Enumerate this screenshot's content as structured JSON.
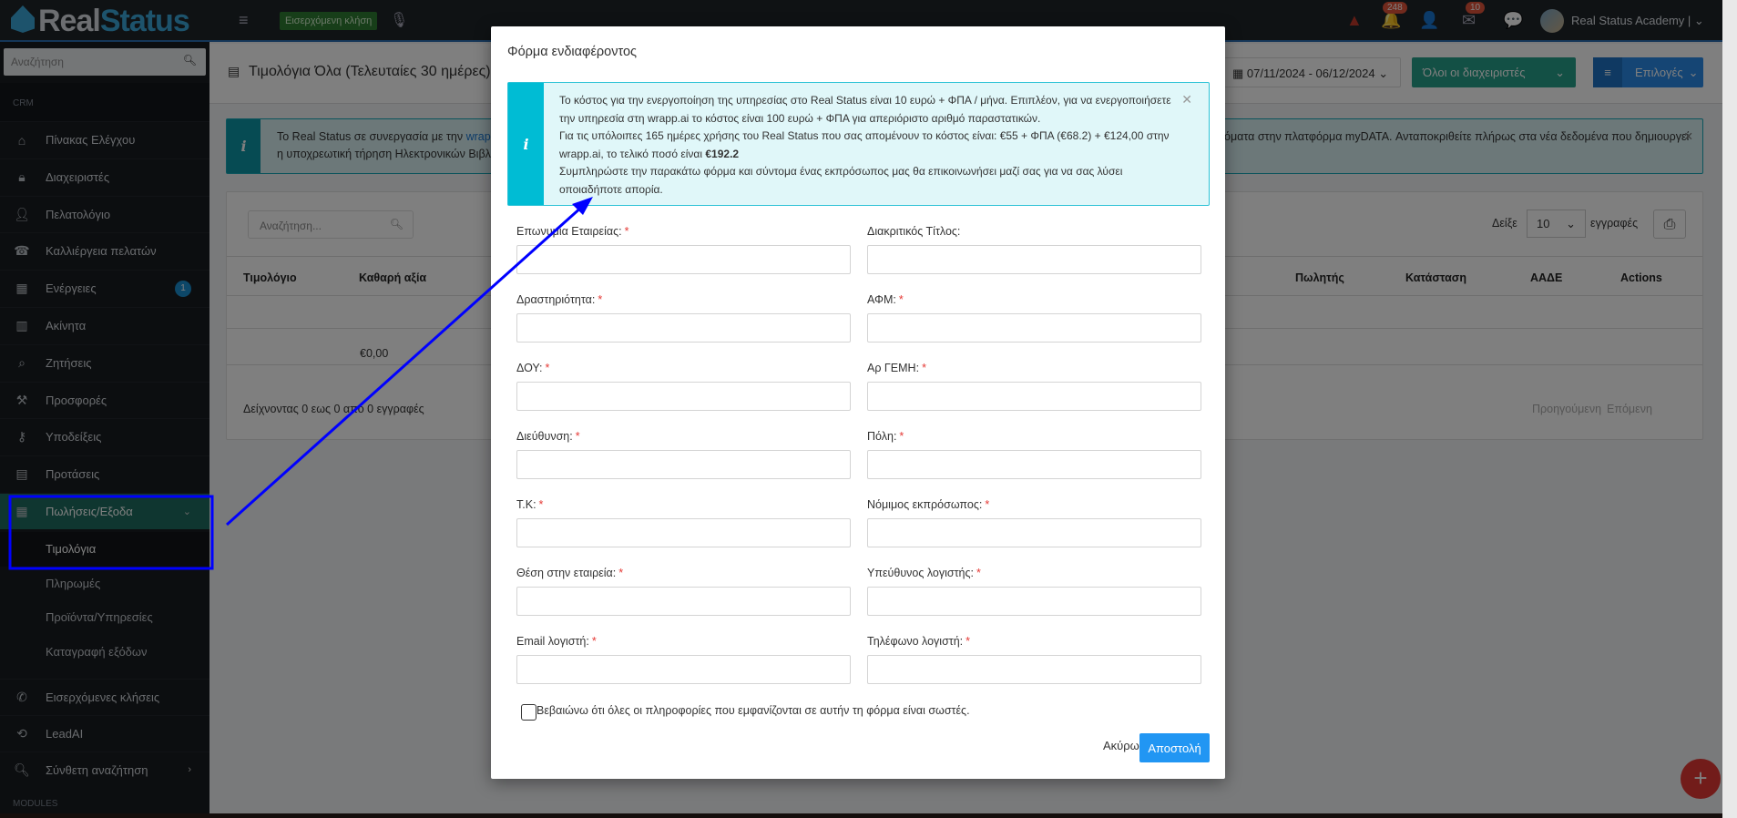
{
  "navbar": {
    "logo_text_1": "Real",
    "logo_text_2": "Status",
    "incoming_call_label": "Εισερχόμενη κλήση",
    "notifications_count": "248",
    "messages_count": "10",
    "user_name": "Real Status Academy |"
  },
  "sidebar": {
    "search_placeholder": "Αναζήτηση",
    "section_crm": "CRM",
    "items": [
      {
        "label": "Πίνακας Ελέγχου",
        "icon": "home"
      },
      {
        "label": "Διαχειριστές",
        "icon": "lock"
      },
      {
        "label": "Πελατολόγιο",
        "icon": "user"
      },
      {
        "label": "Καλλιέργεια πελατών",
        "icon": "phone"
      },
      {
        "label": "Ενέργειες",
        "icon": "calendar",
        "badge": "1"
      },
      {
        "label": "Ακίνητα",
        "icon": "building"
      },
      {
        "label": "Ζητήσεις",
        "icon": "search-folder"
      },
      {
        "label": "Προσφορές",
        "icon": "gavel"
      },
      {
        "label": "Υποδείξεις",
        "icon": "key"
      },
      {
        "label": "Προτάσεις",
        "icon": "list"
      },
      {
        "label": "Πωλήσεις/Εξοδα",
        "icon": "invoice",
        "active": true
      }
    ],
    "sub_items": [
      {
        "label": "Τιμολόγια",
        "active": true
      },
      {
        "label": "Πληρωμές"
      },
      {
        "label": "Προϊόντα/Υπηρεσίες"
      },
      {
        "label": "Καταγραφή εξόδων"
      }
    ],
    "bottom_items": [
      {
        "label": "Εισερχόμενες κλήσεις",
        "icon": "phone-incoming"
      },
      {
        "label": "LeadAI",
        "icon": "sync"
      },
      {
        "label": "Σύνθετη αναζήτηση",
        "icon": "search"
      }
    ],
    "section_modules": "MODULES"
  },
  "page": {
    "title": "Τιμολόγια Όλα (Τελευταίες 30 ημέρες)",
    "date_range": "07/11/2024  -  06/12/2024",
    "managers_button": "Όλοι οι διαχειριστές",
    "options_button": "Επιλογές",
    "alert_line1": "Το Real Status σε συνεργασία με την ",
    "alert_link": "wrapp.a",
    "alert_line2": "η υποχρεωτική τήρηση Ηλεκτρονικών Βιβλί",
    "alert_right": "όματα στην πλατφόρμα myDATA. Ανταποκριθείτε πλήρως στα νέα δεδομένα που δημιουργεί",
    "table_search_placeholder": "Αναζήτηση...",
    "show_label": "Δείξε",
    "page_size": "10",
    "records_label": "εγγραφές",
    "columns_left": [
      "Τιμολόγιο",
      "Καθαρή αξία"
    ],
    "columns_right": [
      "Πωλητής",
      "Κατάσταση",
      "ΑΑΔΕ",
      "Actions"
    ],
    "total_net_value": "€0,00",
    "footer_info": "Δείχνοντας 0 εως 0 από 0 εγγραφές",
    "prev": "Προηγούμενη",
    "next": "Επόμενη"
  },
  "modal": {
    "title": "Φόρμα ενδιαφέροντος",
    "info_line1": "Το κόστος για την ενεργοποίηση της υπηρεσίας στο Real Status είναι 10 ευρώ + ΦΠΑ / μήνα. Επιπλέον, για να ενεργοποιήσετε την υπηρεσία στη wrapp.ai το κόστος είναι 100 ευρώ + ΦΠΑ για απεριόριστο αριθμό παραστατικών.",
    "info_line2": "Για τις υπόλοιπες 165 ημέρες χρήσης του Real Status που σας απομένουν το κόστος είναι: €55 + ΦΠΑ (€68.2) + €124,00 στην wrapp.ai, το τελικό ποσό είναι ",
    "info_total": "€192.2",
    "info_line3": "Συμπληρώστε την παρακάτω φόρμα και σύντομα ένας εκπρόσωπος μας θα επικοινωνήσει μαζί σας για να σας λύσει οποιαδήποτε απορία.",
    "fields": [
      {
        "label": "Επωνυμία Εταιρείας:",
        "required": "*",
        "value": ""
      },
      {
        "label": "Διακριτικός Τίτλος:",
        "required": "",
        "value": ""
      },
      {
        "label": "Δραστηριότητα:",
        "required": "*",
        "value": ""
      },
      {
        "label": "ΑΦΜ:",
        "required": "*",
        "value": ""
      },
      {
        "label": "ΔΟΥ:",
        "required": "*",
        "value": ""
      },
      {
        "label": "Αρ ΓΕΜΗ:",
        "required": "*",
        "value": ""
      },
      {
        "label": "Διεύθυνση:",
        "required": "*",
        "value": ""
      },
      {
        "label": "Πόλη:",
        "required": "*",
        "value": ""
      },
      {
        "label": "Τ.Κ:",
        "required": "*",
        "value": ""
      },
      {
        "label": "Νόμιμος εκπρόσωπος:",
        "required": "*",
        "value": ""
      },
      {
        "label": "Θέση στην εταιρεία:",
        "required": "*",
        "value": ""
      },
      {
        "label": "Υπεύθυνος λογιστής:",
        "required": "*",
        "value": ""
      },
      {
        "label": "Email λογιστή:",
        "required": "*",
        "value": ""
      },
      {
        "label": "Τηλέφωνο λογιστή:",
        "required": "*",
        "value": ""
      }
    ],
    "confirm_label": "Βεβαιώνω ότι όλες οι πληροφορίες που εμφανίζονται σε αυτήν τη φόρμα είναι σωστές.",
    "confirm_checked": false,
    "cancel_label": "Ακύρωση",
    "submit_label": "Αποστολή"
  },
  "colors": {
    "accent": "#2196f3",
    "info": "#00bcd4",
    "sidebar_active": "#1e6d60",
    "annotation": "#0000ff",
    "fab": "#e53935"
  },
  "fab_label": "+"
}
